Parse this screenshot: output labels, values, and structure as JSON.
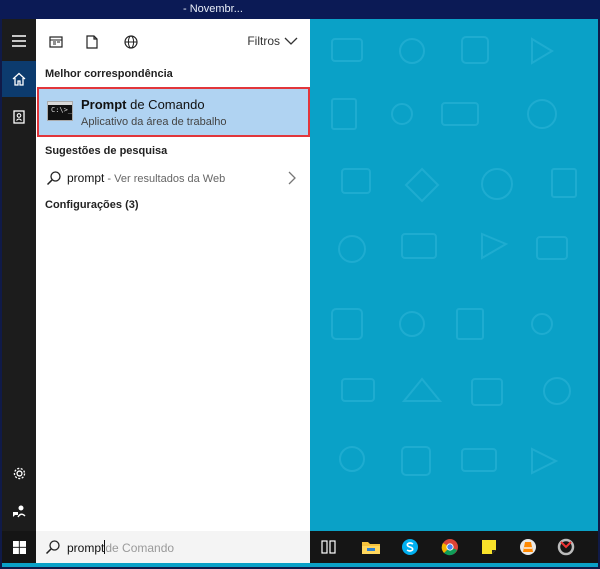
{
  "window": {
    "title": "- Novembr..."
  },
  "rail": {
    "items": [
      {
        "icon": "hamburger-menu-icon"
      },
      {
        "icon": "home-icon"
      },
      {
        "icon": "notebook-icon"
      },
      {
        "icon": "gear-icon"
      },
      {
        "icon": "feedback-icon"
      }
    ]
  },
  "search_panel": {
    "tabs": [
      {
        "icon": "apps-icon"
      },
      {
        "icon": "documents-icon"
      },
      {
        "icon": "web-globe-icon"
      }
    ],
    "filters_label": "Filtros",
    "best_match_heading": "Melhor correspondência",
    "best_match": {
      "name_bold": "Prompt",
      "name_rest": " de Comando",
      "subtitle": "Aplicativo da área de trabalho",
      "icon_glyph": "C:\\>_"
    },
    "suggestions_heading": "Sugestões de pesquisa",
    "suggestion": {
      "query": "prompt",
      "hint": " - Ver resultados da Web"
    },
    "settings_heading": "Configurações (3)"
  },
  "search_box": {
    "typed": "prompt",
    "autocomplete": "de Comando"
  },
  "taskbar": {
    "apps": [
      {
        "icon": "task-view-icon"
      },
      {
        "icon": "file-explorer-icon"
      },
      {
        "icon": "skype-icon"
      },
      {
        "icon": "chrome-icon"
      },
      {
        "icon": "sticky-notes-icon"
      },
      {
        "icon": "vlc-icon"
      },
      {
        "icon": "app-icon"
      }
    ]
  },
  "colors": {
    "desktop": "#0aa1c7",
    "selection": "#b0d3f2",
    "selection_border": "#e2363b",
    "rail": "#1c1c1c",
    "taskbar": "#151515"
  }
}
